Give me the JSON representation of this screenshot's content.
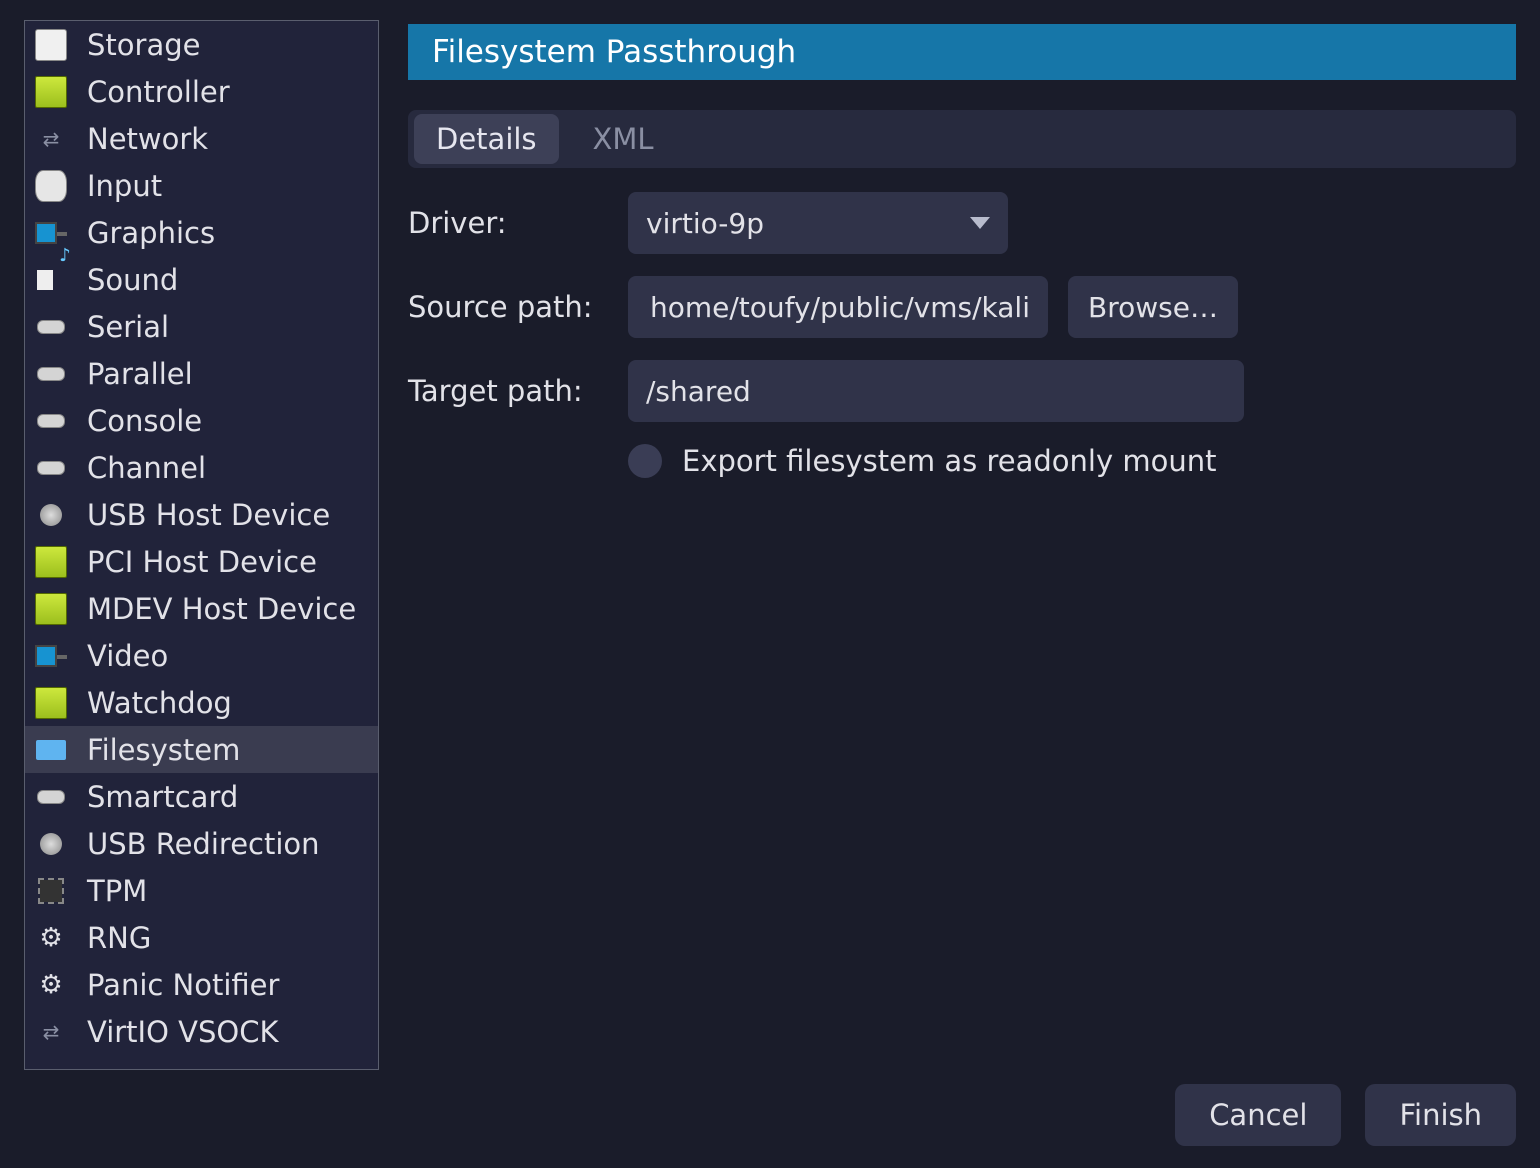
{
  "sidebar": {
    "items": [
      {
        "label": "Storage",
        "icon": "disk",
        "selected": false
      },
      {
        "label": "Controller",
        "icon": "card",
        "selected": false
      },
      {
        "label": "Network",
        "icon": "arrows",
        "selected": false
      },
      {
        "label": "Input",
        "icon": "mouse",
        "selected": false
      },
      {
        "label": "Graphics",
        "icon": "monitor",
        "selected": false
      },
      {
        "label": "Sound",
        "icon": "sound",
        "selected": false
      },
      {
        "label": "Serial",
        "icon": "connector",
        "selected": false
      },
      {
        "label": "Parallel",
        "icon": "connector",
        "selected": false
      },
      {
        "label": "Console",
        "icon": "connector",
        "selected": false
      },
      {
        "label": "Channel",
        "icon": "connector",
        "selected": false
      },
      {
        "label": "USB Host Device",
        "icon": "usb",
        "selected": false
      },
      {
        "label": "PCI Host Device",
        "icon": "card",
        "selected": false
      },
      {
        "label": "MDEV Host Device",
        "icon": "card",
        "selected": false
      },
      {
        "label": "Video",
        "icon": "monitor",
        "selected": false
      },
      {
        "label": "Watchdog",
        "icon": "card",
        "selected": false
      },
      {
        "label": "Filesystem",
        "icon": "folder",
        "selected": true
      },
      {
        "label": "Smartcard",
        "icon": "connector",
        "selected": false
      },
      {
        "label": "USB Redirection",
        "icon": "usb",
        "selected": false
      },
      {
        "label": "TPM",
        "icon": "chip",
        "selected": false
      },
      {
        "label": "RNG",
        "icon": "gear",
        "selected": false
      },
      {
        "label": "Panic Notifier",
        "icon": "gear",
        "selected": false
      },
      {
        "label": "VirtIO VSOCK",
        "icon": "arrows",
        "selected": false
      }
    ]
  },
  "header": {
    "title": "Filesystem Passthrough"
  },
  "tabs": {
    "details": "Details",
    "xml": "XML",
    "active": "details"
  },
  "form": {
    "driver_label": "Driver:",
    "driver_value": "virtio-9p",
    "source_label": "Source path:",
    "source_value": "home/toufy/public/vms/kali",
    "browse_label": "Browse…",
    "target_label": "Target path:",
    "target_value": "/shared",
    "readonly_label": "Export filesystem as readonly mount",
    "readonly_checked": false
  },
  "footer": {
    "cancel": "Cancel",
    "finish": "Finish"
  }
}
